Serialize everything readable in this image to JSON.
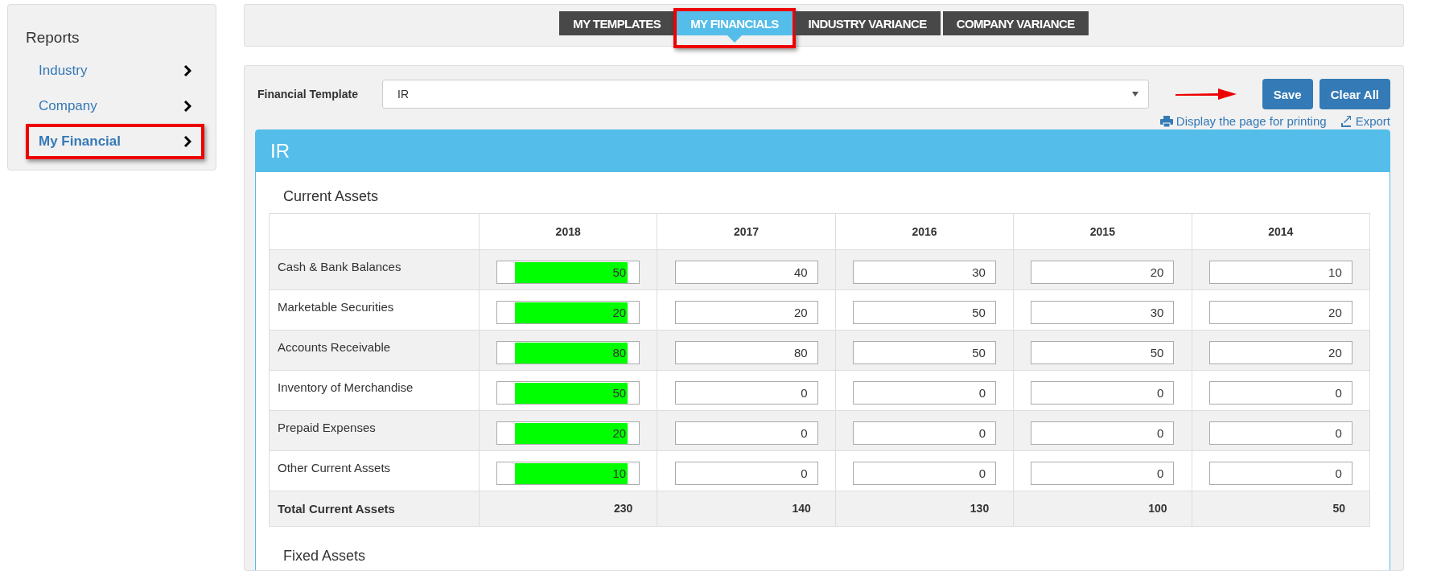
{
  "sidebar": {
    "title": "Reports",
    "items": [
      {
        "label": "Industry",
        "selected": false,
        "highlighted": false
      },
      {
        "label": "Company",
        "selected": false,
        "highlighted": false
      },
      {
        "label": "My Financial",
        "selected": true,
        "highlighted": true
      }
    ]
  },
  "tabs": [
    {
      "label": "MY TEMPLATES",
      "selected": false,
      "highlighted": false
    },
    {
      "label": "MY FINANCIALS",
      "selected": true,
      "highlighted": true
    },
    {
      "label": "INDUSTRY VARIANCE",
      "selected": false,
      "highlighted": false
    },
    {
      "label": "COMPANY VARIANCE",
      "selected": false,
      "highlighted": false
    }
  ],
  "template": {
    "label": "Financial Template",
    "value": "IR"
  },
  "buttons": [
    {
      "label": "Save",
      "pointed": true
    },
    {
      "label": "Clear All",
      "pointed": false
    }
  ],
  "links": [
    {
      "kind": "print",
      "label": "Display the page for printing"
    },
    {
      "kind": "export",
      "label": "Export"
    }
  ],
  "report": {
    "title": "IR",
    "section": "Current Assets",
    "next_section": "Fixed Assets",
    "table": {
      "columns": [
        "2018",
        "2017",
        "2016",
        "2015",
        "2014"
      ],
      "rows": [
        {
          "label": "Cash & Bank Balances",
          "cells": [
            {
              "value": "50",
              "highlighted": true
            },
            {
              "value": "40",
              "highlighted": false
            },
            {
              "value": "30",
              "highlighted": false
            },
            {
              "value": "20",
              "highlighted": false
            },
            {
              "value": "10",
              "highlighted": false
            }
          ]
        },
        {
          "label": "Marketable Securities",
          "cells": [
            {
              "value": "20",
              "highlighted": true
            },
            {
              "value": "20",
              "highlighted": false
            },
            {
              "value": "50",
              "highlighted": false
            },
            {
              "value": "30",
              "highlighted": false
            },
            {
              "value": "20",
              "highlighted": false
            }
          ]
        },
        {
          "label": "Accounts Receivable",
          "cells": [
            {
              "value": "80",
              "highlighted": true
            },
            {
              "value": "80",
              "highlighted": false
            },
            {
              "value": "50",
              "highlighted": false
            },
            {
              "value": "50",
              "highlighted": false
            },
            {
              "value": "20",
              "highlighted": false
            }
          ]
        },
        {
          "label": "Inventory of Merchandise",
          "cells": [
            {
              "value": "50",
              "highlighted": true
            },
            {
              "value": "0",
              "highlighted": false
            },
            {
              "value": "0",
              "highlighted": false
            },
            {
              "value": "0",
              "highlighted": false
            },
            {
              "value": "0",
              "highlighted": false
            }
          ]
        },
        {
          "label": "Prepaid Expenses",
          "cells": [
            {
              "value": "20",
              "highlighted": true
            },
            {
              "value": "0",
              "highlighted": false
            },
            {
              "value": "0",
              "highlighted": false
            },
            {
              "value": "0",
              "highlighted": false
            },
            {
              "value": "0",
              "highlighted": false
            }
          ]
        },
        {
          "label": "Other Current Assets",
          "cells": [
            {
              "value": "10",
              "highlighted": true
            },
            {
              "value": "0",
              "highlighted": false
            },
            {
              "value": "0",
              "highlighted": false
            },
            {
              "value": "0",
              "highlighted": false
            },
            {
              "value": "0",
              "highlighted": false
            }
          ]
        }
      ],
      "total": {
        "label": "Total Current Assets",
        "values": [
          "230",
          "140",
          "130",
          "100",
          "50"
        ]
      }
    }
  }
}
